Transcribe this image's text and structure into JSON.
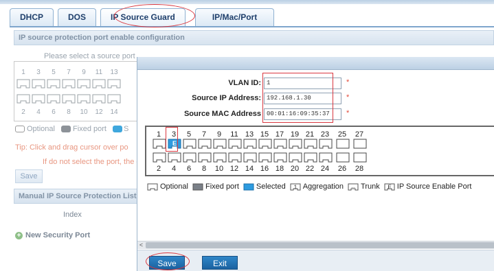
{
  "tabs": [
    {
      "label": "DHCP"
    },
    {
      "label": "DOS"
    },
    {
      "label": "IP Source Guard"
    },
    {
      "label": "IP/Mac/Port"
    }
  ],
  "background": {
    "section1_title": "IP source protection port enable configuration",
    "select_prompt": "Please select a source port",
    "port_top_numbers": [
      "1",
      "3",
      "5",
      "7",
      "9",
      "11",
      "13"
    ],
    "port_bottom_numbers": [
      "2",
      "4",
      "6",
      "8",
      "10",
      "12",
      "14"
    ],
    "legend_optional": "Optional",
    "legend_fixed": "Fixed port",
    "legend_s": "S",
    "tip_line1": "Tip: Click and drag cursor over po",
    "tip_line2": "If do not select the port, the c",
    "save_label": "Save",
    "section2_title": "Manual IP Source Protection List",
    "index_header": "Index",
    "new_security_port": "New Security Port"
  },
  "dialog": {
    "vlan_label": "VLAN ID:",
    "vlan_value": "1",
    "ip_label": "Source IP Address:",
    "ip_value": "192.168.1.30",
    "mac_label": "Source MAC Address",
    "mac_value": "00:01:16:09:35:37",
    "required_mark": "*",
    "top_ports": [
      "1",
      "3",
      "5",
      "7",
      "9",
      "11",
      "13",
      "15",
      "17",
      "19",
      "21",
      "23",
      "25",
      "27"
    ],
    "bottom_ports": [
      "2",
      "4",
      "6",
      "8",
      "10",
      "12",
      "14",
      "16",
      "18",
      "20",
      "22",
      "24",
      "26",
      "28"
    ],
    "selected_port": "3",
    "selected_port_letter": "E",
    "legend": {
      "optional": "Optional",
      "fixed": "Fixed port",
      "selected": "Selected",
      "aggregation_number": "1",
      "aggregation": "Aggregation",
      "trunk_mark": "...",
      "trunk": "Trunk",
      "ipsource_letter": "E",
      "ipsource": "IP Source Enable Port"
    },
    "scroll_arrow": "<",
    "save_label": "Save",
    "exit_label": "Exit"
  }
}
